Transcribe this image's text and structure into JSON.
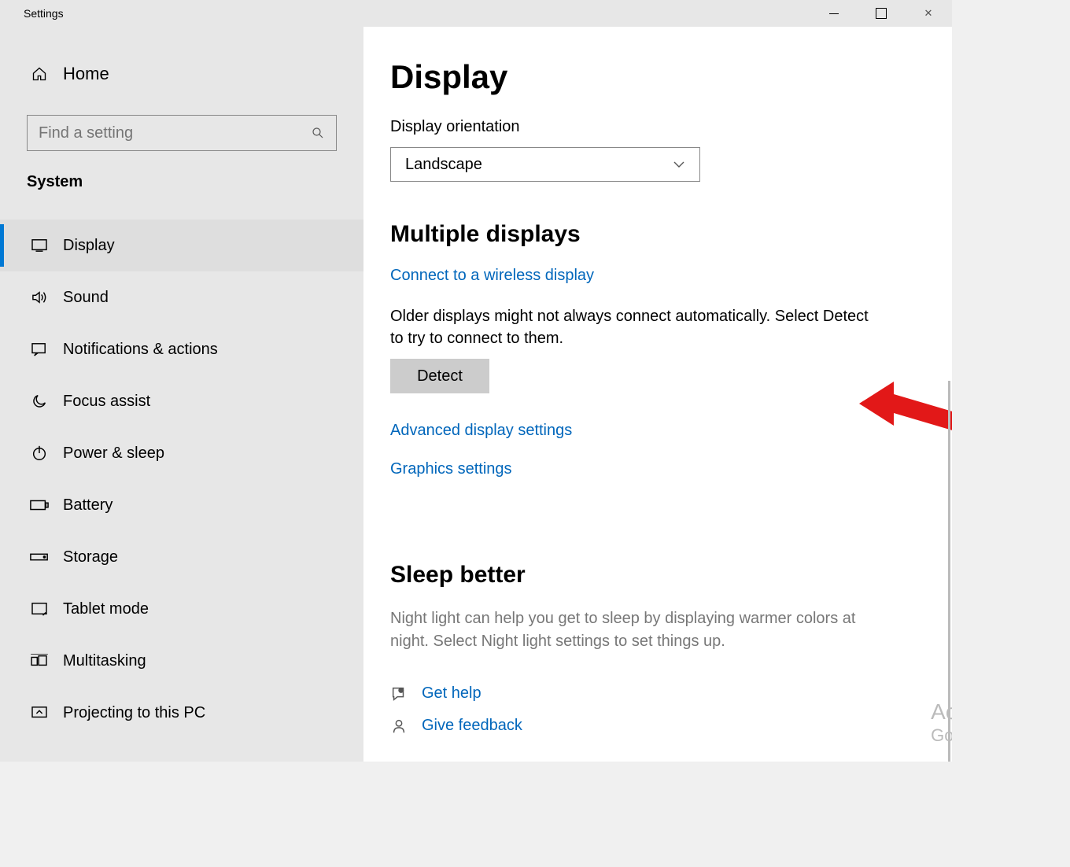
{
  "window": {
    "title": "Settings"
  },
  "sidebar": {
    "home_label": "Home",
    "search_placeholder": "Find a setting",
    "category_label": "System",
    "items": [
      {
        "label": "Display",
        "icon": "display",
        "active": true
      },
      {
        "label": "Sound",
        "icon": "sound",
        "active": false
      },
      {
        "label": "Notifications & actions",
        "icon": "notifications",
        "active": false
      },
      {
        "label": "Focus assist",
        "icon": "focus",
        "active": false
      },
      {
        "label": "Power & sleep",
        "icon": "power",
        "active": false
      },
      {
        "label": "Battery",
        "icon": "battery",
        "active": false
      },
      {
        "label": "Storage",
        "icon": "storage",
        "active": false
      },
      {
        "label": "Tablet mode",
        "icon": "tablet",
        "active": false
      },
      {
        "label": "Multitasking",
        "icon": "multitask",
        "active": false
      },
      {
        "label": "Projecting to this PC",
        "icon": "project",
        "active": false
      }
    ]
  },
  "content": {
    "page_title": "Display",
    "orientation_label": "Display orientation",
    "orientation_value": "Landscape",
    "multi_title": "Multiple displays",
    "wireless_link": "Connect to a wireless display",
    "detect_hint": "Older displays might not always connect automatically. Select Detect to try to connect to them.",
    "detect_button": "Detect",
    "adv_link": "Advanced display settings",
    "gfx_link": "Graphics settings",
    "sleep_title": "Sleep better",
    "sleep_para": "Night light can help you get to sleep by displaying warmer colors at night. Select Night light settings to set things up.",
    "help_link": "Get help",
    "feedback_link": "Give feedback",
    "watermark_line1": "Activa",
    "watermark_line2": "Go to Se"
  }
}
